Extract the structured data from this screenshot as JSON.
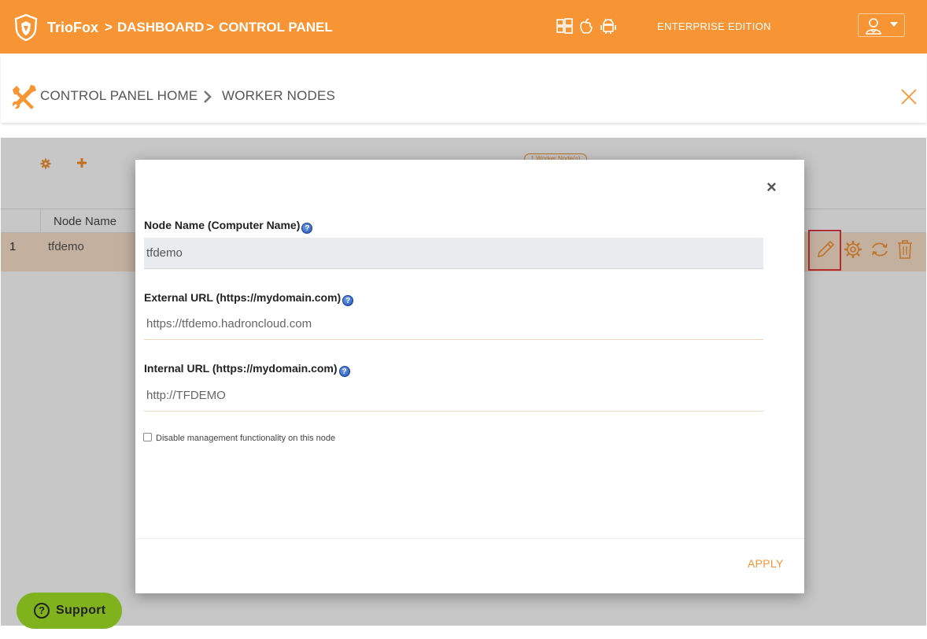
{
  "header": {
    "brand": "TrioFox",
    "crumb_dashboard": "DASHBOARD",
    "crumb_control_panel": "CONTROL PANEL",
    "crumb_sep": ">",
    "edition": "ENTERPRISE EDITION",
    "os_icons": [
      "windows-icon",
      "apple-icon",
      "android-icon"
    ],
    "user_icon": "user-icon"
  },
  "subheader": {
    "home": "CONTROL PANEL HOME",
    "current": "WORKER NODES"
  },
  "content": {
    "count_badge": "1 Worker Node(s)",
    "table": {
      "columns": [
        "Node Name"
      ],
      "rows": [
        {
          "index": "1",
          "name": "tfdemo"
        }
      ]
    }
  },
  "modal": {
    "close": "×",
    "node_name_label": "Node Name (Computer Name)",
    "node_name_value": "tfdemo",
    "external_url_label": "External URL (https://mydomain.com)",
    "external_url_value": "https://tfdemo.hadroncloud.com",
    "internal_url_label": "Internal URL (https://mydomain.com)",
    "internal_url_value": "http://TFDEMO",
    "checkbox_label": "Disable management functionality on this node",
    "checkbox_checked": false,
    "apply": "APPLY",
    "help_glyph": "?"
  },
  "support": {
    "label": "Support",
    "glyph": "?"
  },
  "colors": {
    "accent": "#f79433",
    "highlight_row": "#fbe2cc",
    "support_green": "#80b21e",
    "edit_outline": "#e8393b"
  }
}
